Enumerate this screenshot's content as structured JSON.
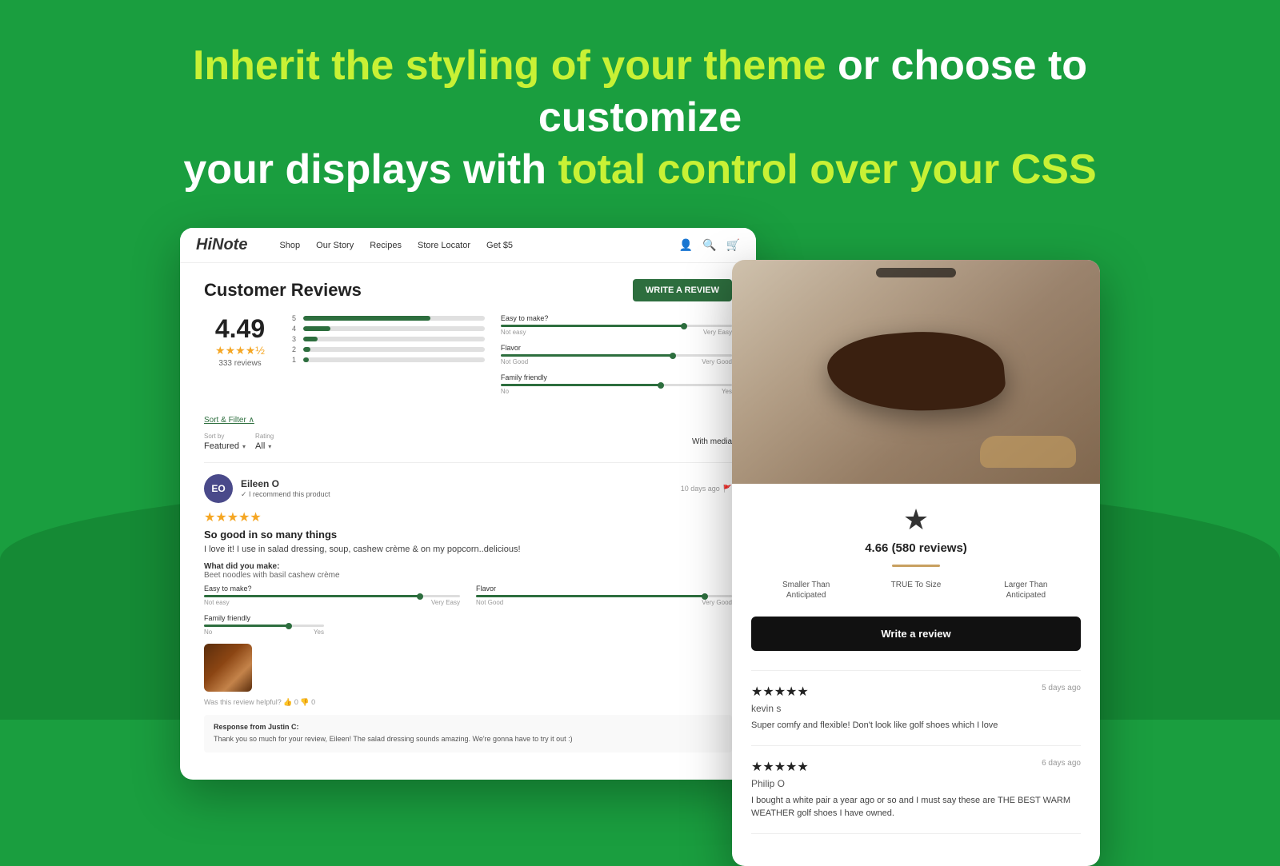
{
  "page": {
    "background_color": "#1a9e3f"
  },
  "headline": {
    "part1": "Inherit the styling of your theme",
    "part2": "or choose to customize",
    "part3": "your displays with",
    "part4": "total control over your CSS"
  },
  "left_screenshot": {
    "nav": {
      "logo": "HiNote",
      "links": [
        "Shop",
        "Our Story",
        "Recipes",
        "Store Locator",
        "Get $5"
      ]
    },
    "reviews": {
      "title": "Customer Reviews",
      "write_button": "WRITE A REVIEW",
      "overall_rating": "4.49",
      "stars": "★★★★½",
      "review_count": "333 reviews",
      "bars": [
        {
          "num": "5",
          "width": "70%"
        },
        {
          "num": "4",
          "width": "15%"
        },
        {
          "num": "3",
          "width": "8%"
        },
        {
          "num": "2",
          "width": "4%"
        },
        {
          "num": "1",
          "width": "3%"
        }
      ],
      "sliders": [
        {
          "label": "Easy to make?",
          "left_label": "Not easy",
          "right_label": "Very Easy",
          "position": "80%"
        },
        {
          "label": "Flavor",
          "left_label": "Not Good",
          "right_label": "Very Good",
          "position": "75%"
        },
        {
          "label": "Family friendly",
          "left_label": "No",
          "right_label": "Yes",
          "position": "70%"
        }
      ],
      "sort_filter": "Sort & Filter ∧",
      "sort_by_label": "Sort by",
      "sort_by_value": "Featured",
      "rating_label": "Rating",
      "rating_value": "All",
      "with_media": "With media",
      "review": {
        "avatar_initials": "EO",
        "reviewer_name": "Eileen O",
        "recommend": "✓ I recommend this product",
        "date": "10 days ago",
        "stars": "★★★★★",
        "title": "So good in so many things",
        "text": "I love it! I use in salad dressing, soup, cashew crème & on my popcorn..delicious!",
        "made_label": "What did you make:",
        "made_value": "Beet noodles with basil cashew crème",
        "sliders": [
          {
            "label": "Easy to make?",
            "left": "Not easy",
            "right": "Very Easy",
            "pos": "85%"
          },
          {
            "label": "Flavor",
            "left": "Not Good",
            "right": "Very Good",
            "pos": "90%"
          }
        ],
        "family_label": "Family friendly",
        "family_left": "No",
        "family_right": "Yes",
        "family_pos": "70%",
        "helpful_text": "Was this review helpful?",
        "helpful_yes": "0",
        "helpful_no": "0",
        "response_from": "Response from Justin C:",
        "response_text": "Thank you so much for your review, Eileen! The salad dressing sounds amazing. We're gonna have to try it out :)"
      }
    }
  },
  "right_screenshot": {
    "star": "★",
    "rating": "4.66 (580 reviews)",
    "fit": [
      {
        "label": "Smaller Than\nAnticipated"
      },
      {
        "label": "TRUE To Size"
      },
      {
        "label": "Larger Than\nAnticipated"
      }
    ],
    "write_review_btn": "Write a review",
    "reviews": [
      {
        "stars": "★★★★★",
        "date": "5 days ago",
        "reviewer": "kevin s",
        "text": "Super comfy and flexible! Don't look like golf shoes which I love"
      },
      {
        "stars": "★★★★★",
        "date": "6 days ago",
        "reviewer": "Philip O",
        "text": "I bought a white pair a year ago or so and I must say these are THE BEST WARM WEATHER golf shoes I have owned."
      }
    ]
  }
}
